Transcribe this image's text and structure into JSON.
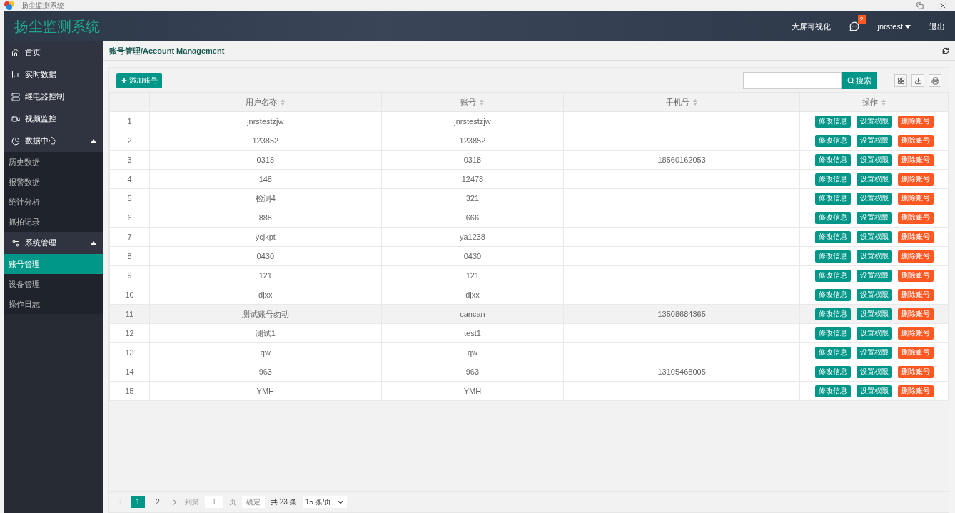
{
  "window": {
    "title": "扬尘监测系统"
  },
  "header": {
    "app_name": "扬尘监测系统",
    "links": [
      {
        "kind": "link",
        "label": "大屏可视化"
      },
      {
        "kind": "messages",
        "badge": "2"
      },
      {
        "kind": "user",
        "label": "jnrstest"
      },
      {
        "kind": "link",
        "label": "退出"
      }
    ]
  },
  "sidebar": {
    "items": [
      {
        "label": "首页",
        "selected": false
      },
      {
        "label": "实时数据",
        "selected": false
      },
      {
        "label": "继电器控制",
        "selected": false
      },
      {
        "label": "视频监控",
        "selected": false
      },
      {
        "label": "数据中心",
        "selected": false,
        "expanded": true,
        "children": [
          {
            "label": "历史数据",
            "selected": false
          },
          {
            "label": "报警数据",
            "selected": false
          },
          {
            "label": "统计分析",
            "selected": false
          },
          {
            "label": "抓拍记录",
            "selected": false
          }
        ]
      },
      {
        "label": "系统管理",
        "selected": false,
        "expanded": true,
        "children": [
          {
            "label": "账号管理",
            "selected": true
          },
          {
            "label": "设备管理",
            "selected": false
          },
          {
            "label": "操作日志",
            "selected": false
          }
        ]
      }
    ]
  },
  "breadcrumb": "账号管理/Account Management",
  "toolbar": {
    "add_button": "添加账号",
    "search": {
      "button": "搜索"
    }
  },
  "table": {
    "columns": [
      "",
      "用户名称",
      "账号",
      "手机号",
      "操作"
    ],
    "rows": [
      {
        "cells": [
          "1",
          "jnrstestzjw",
          "jnrstestzjw",
          ""
        ],
        "highlighted": false,
        "actions": [
          {
            "label": "修改信息",
            "kind": "primary"
          },
          {
            "label": "设置权限",
            "kind": "primary"
          },
          {
            "label": "删除账号",
            "kind": "danger"
          }
        ]
      },
      {
        "cells": [
          "2",
          "123852",
          "123852",
          ""
        ],
        "highlighted": false,
        "actions": [
          {
            "label": "修改信息",
            "kind": "primary"
          },
          {
            "label": "设置权限",
            "kind": "primary"
          },
          {
            "label": "删除账号",
            "kind": "danger"
          }
        ]
      },
      {
        "cells": [
          "3",
          "0318",
          "0318",
          "18560162053"
        ],
        "highlighted": false,
        "actions": [
          {
            "label": "修改信息",
            "kind": "primary"
          },
          {
            "label": "设置权限",
            "kind": "primary"
          },
          {
            "label": "删除账号",
            "kind": "danger"
          }
        ]
      },
      {
        "cells": [
          "4",
          "148",
          "12478",
          ""
        ],
        "highlighted": false,
        "actions": [
          {
            "label": "修改信息",
            "kind": "primary"
          },
          {
            "label": "设置权限",
            "kind": "primary"
          },
          {
            "label": "删除账号",
            "kind": "danger"
          }
        ]
      },
      {
        "cells": [
          "5",
          "检测4",
          "321",
          ""
        ],
        "highlighted": false,
        "actions": [
          {
            "label": "修改信息",
            "kind": "primary"
          },
          {
            "label": "设置权限",
            "kind": "primary"
          },
          {
            "label": "删除账号",
            "kind": "danger"
          }
        ]
      },
      {
        "cells": [
          "6",
          "888",
          "666",
          ""
        ],
        "highlighted": false,
        "actions": [
          {
            "label": "修改信息",
            "kind": "primary"
          },
          {
            "label": "设置权限",
            "kind": "primary"
          },
          {
            "label": "删除账号",
            "kind": "danger"
          }
        ]
      },
      {
        "cells": [
          "7",
          "ycjkpt",
          "ya1238",
          ""
        ],
        "highlighted": false,
        "actions": [
          {
            "label": "修改信息",
            "kind": "primary"
          },
          {
            "label": "设置权限",
            "kind": "primary"
          },
          {
            "label": "删除账号",
            "kind": "danger"
          }
        ]
      },
      {
        "cells": [
          "8",
          "0430",
          "0430",
          ""
        ],
        "highlighted": false,
        "actions": [
          {
            "label": "修改信息",
            "kind": "primary"
          },
          {
            "label": "设置权限",
            "kind": "primary"
          },
          {
            "label": "删除账号",
            "kind": "danger"
          }
        ]
      },
      {
        "cells": [
          "9",
          "121",
          "121",
          ""
        ],
        "highlighted": false,
        "actions": [
          {
            "label": "修改信息",
            "kind": "primary"
          },
          {
            "label": "设置权限",
            "kind": "primary"
          },
          {
            "label": "删除账号",
            "kind": "danger"
          }
        ]
      },
      {
        "cells": [
          "10",
          "djxx",
          "djxx",
          ""
        ],
        "highlighted": false,
        "actions": [
          {
            "label": "修改信息",
            "kind": "primary"
          },
          {
            "label": "设置权限",
            "kind": "primary"
          },
          {
            "label": "删除账号",
            "kind": "danger"
          }
        ]
      },
      {
        "cells": [
          "11",
          "测试账号勿动",
          "cancan",
          "13508684365"
        ],
        "highlighted": true,
        "actions": [
          {
            "label": "修改信息",
            "kind": "primary"
          },
          {
            "label": "设置权限",
            "kind": "primary"
          },
          {
            "label": "删除账号",
            "kind": "danger"
          }
        ]
      },
      {
        "cells": [
          "12",
          "测试1",
          "test1",
          ""
        ],
        "highlighted": false,
        "actions": [
          {
            "label": "修改信息",
            "kind": "primary"
          },
          {
            "label": "设置权限",
            "kind": "primary"
          },
          {
            "label": "删除账号",
            "kind": "danger"
          }
        ]
      },
      {
        "cells": [
          "13",
          "qw",
          "qw",
          ""
        ],
        "highlighted": false,
        "actions": [
          {
            "label": "修改信息",
            "kind": "primary"
          },
          {
            "label": "设置权限",
            "kind": "primary"
          },
          {
            "label": "删除账号",
            "kind": "danger"
          }
        ]
      },
      {
        "cells": [
          "14",
          "963",
          "963",
          "13105468005"
        ],
        "highlighted": false,
        "actions": [
          {
            "label": "修改信息",
            "kind": "primary"
          },
          {
            "label": "设置权限",
            "kind": "primary"
          },
          {
            "label": "删除账号",
            "kind": "danger"
          }
        ]
      },
      {
        "cells": [
          "15",
          "YMH",
          "YMH",
          ""
        ],
        "highlighted": false,
        "actions": [
          {
            "label": "修改信息",
            "kind": "primary"
          },
          {
            "label": "设置权限",
            "kind": "primary"
          },
          {
            "label": "删除账号",
            "kind": "danger"
          }
        ]
      }
    ]
  },
  "pagination": {
    "pages": [
      {
        "label": "1",
        "selected": true
      },
      {
        "label": "2",
        "selected": false
      }
    ],
    "prev_disabled": true,
    "goto_label": "到第",
    "goto_value": "1",
    "page_unit": "页",
    "confirm": "确定",
    "total": "共 23 条",
    "page_size": "15 条/页"
  }
}
